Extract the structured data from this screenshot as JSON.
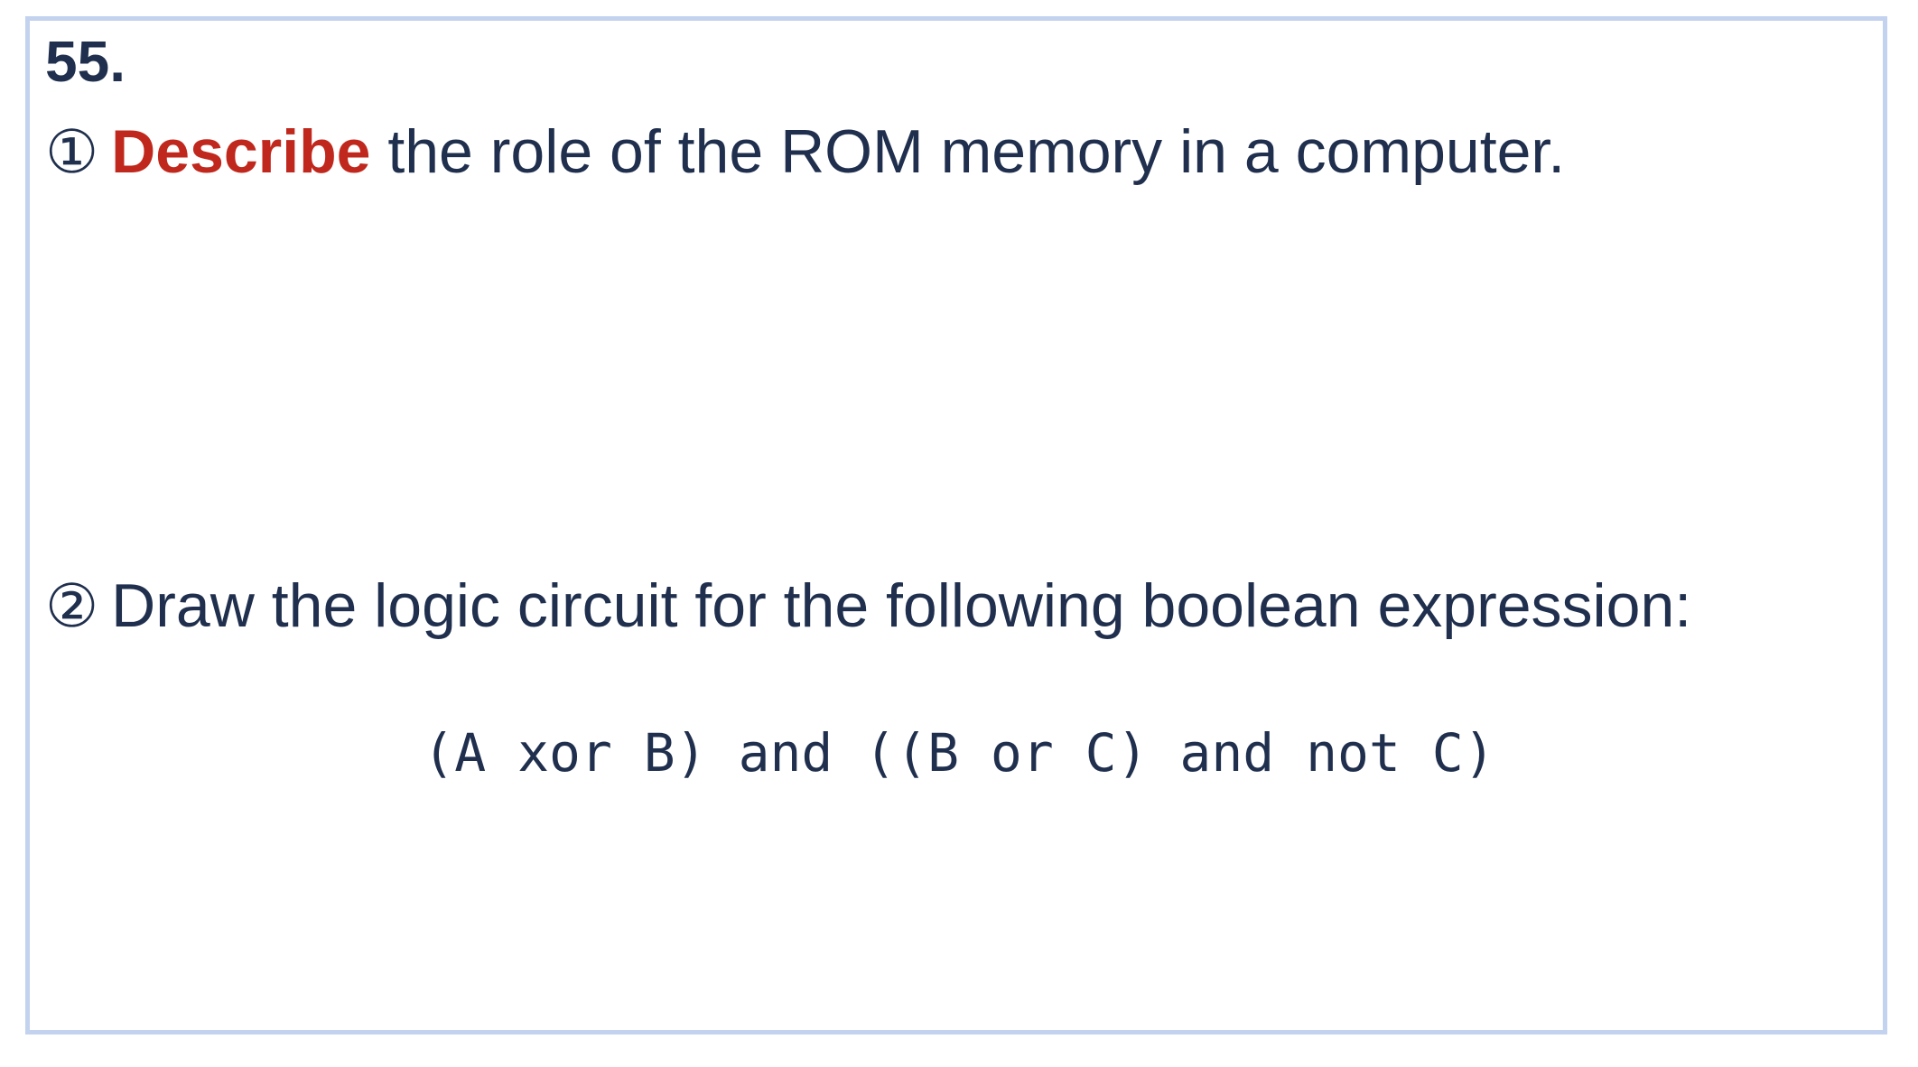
{
  "question": {
    "number": "55.",
    "part1": {
      "marker": "①",
      "keyword": "Describe",
      "text": " the role of the ROM memory in a computer."
    },
    "part2": {
      "marker": "②",
      "text": "Draw the logic circuit for the following boolean expression:"
    },
    "expression": "(A xor B) and ((B or C) and not C)"
  },
  "colors": {
    "text": "#1f2f4d",
    "keyword": "#c0281d",
    "border": "#c3d2ef"
  }
}
